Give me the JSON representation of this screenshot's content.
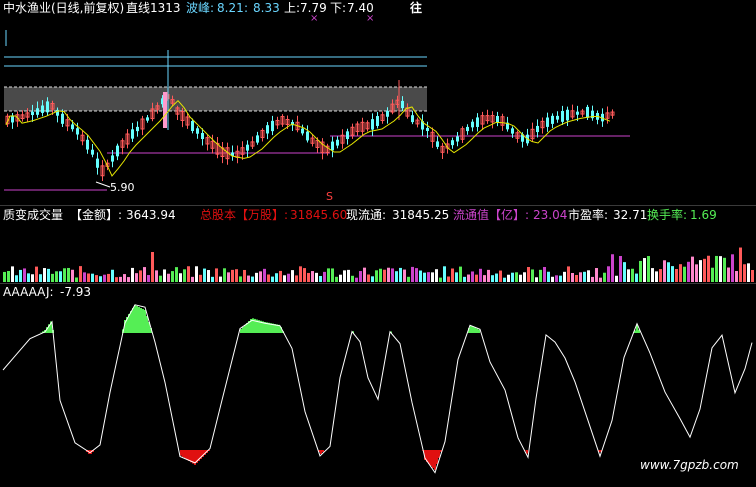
{
  "colors": {
    "up": "#ff5a5a",
    "down": "#66ffff",
    "ma": "#e6e600",
    "purple": "#cc44cc",
    "green": "#55ee55",
    "white": "#ffffff",
    "lightblue": "#6ad6ff",
    "red": "#e01010"
  },
  "header": {
    "stock_name": "中水渔业(日线,前复权)",
    "line_label": "直线1313",
    "wave_label": "波峰:",
    "wave_val1": "8.21",
    "wave_val2": "8.33",
    "up_label": "上:",
    "up_val": "7.79",
    "down_label": "下:",
    "down_val": "7.40",
    "right_text": "往",
    "markers": [
      "×",
      "×"
    ]
  },
  "price_panel": {
    "low_annotation": "5.90",
    "s_marker": "S"
  },
  "volume_panel": {
    "title": "质变成交量",
    "amount_label": "【金额】:",
    "amount_value": "3643.94",
    "total_shares_label": "总股本【万股】:",
    "total_shares_value": "31845.60",
    "float_label": "现流通:",
    "float_value": "31845.25",
    "float_cap_label": "流通值【亿】:",
    "float_cap_value": "23.04",
    "pe_label": "市盈率:",
    "pe_value": "32.71",
    "turnover_label": "换手率:",
    "turnover_value": "1.69"
  },
  "indicator_panel": {
    "title": "AAAAA",
    "j_label": "J:",
    "j_value": "-7.93"
  },
  "watermark": "www.7gpzb.com"
}
